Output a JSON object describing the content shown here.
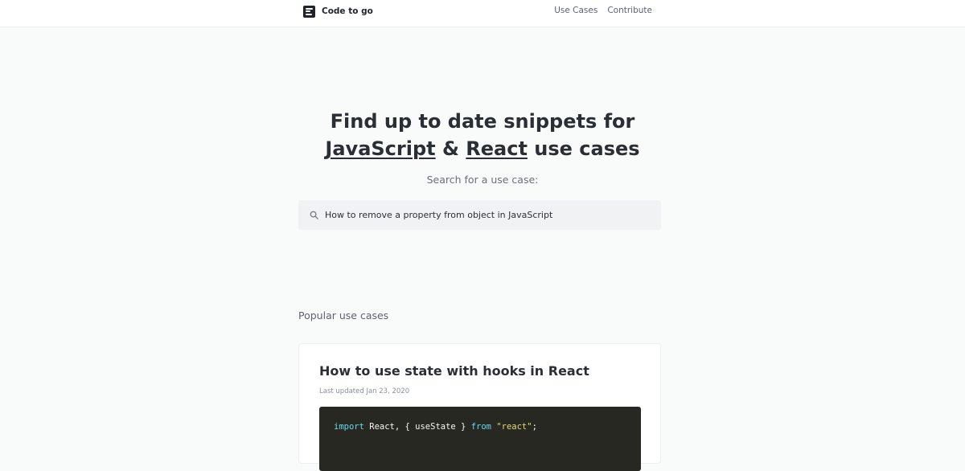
{
  "header": {
    "brand": "Code to go",
    "nav": [
      "Use Cases",
      "Contribute"
    ]
  },
  "hero": {
    "title_line1": "Find up to date snippets for",
    "title_js": "JavaScript",
    "title_amp": "&",
    "title_react": "React",
    "title_tail": "use cases",
    "search_label": "Search for a use case:",
    "search_placeholder": "How to remove a property from object in JavaScript"
  },
  "popular": {
    "title": "Popular use cases",
    "cards": [
      {
        "title": "How to use state with hooks in React",
        "updated": "Last updated Jan 23, 2020",
        "code": {
          "kw_import": "import",
          "text1": " React, { useState } ",
          "kw_from": "from",
          "string": "\"react\"",
          "end": ";"
        }
      }
    ]
  },
  "colors": {
    "background": "#f9fafa",
    "code_background": "#272822",
    "keyword": "#66d9ef",
    "string": "#e6db74"
  }
}
